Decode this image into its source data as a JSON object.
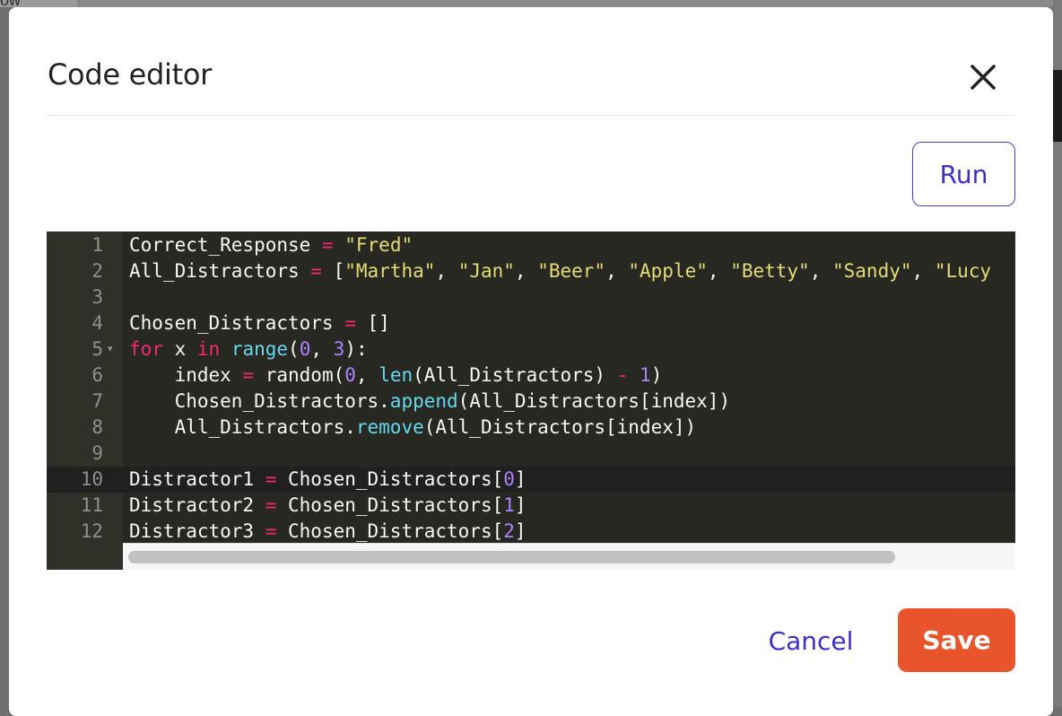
{
  "background": {
    "fragment_text": "ow"
  },
  "modal": {
    "title": "Code editor",
    "close_icon": "close-icon"
  },
  "toolbar": {
    "run_label": "Run"
  },
  "editor": {
    "theme": "monokai",
    "active_line": 10,
    "lines": [
      {
        "number": "1",
        "tokens": [
          {
            "t": "Correct_Response ",
            "c": "pl"
          },
          {
            "t": "=",
            "c": "op"
          },
          {
            "t": " ",
            "c": "pl"
          },
          {
            "t": "\"Fred\"",
            "c": "str"
          }
        ]
      },
      {
        "number": "2",
        "tokens": [
          {
            "t": "All_Distractors ",
            "c": "pl"
          },
          {
            "t": "=",
            "c": "op"
          },
          {
            "t": " [",
            "c": "pl"
          },
          {
            "t": "\"Martha\"",
            "c": "str"
          },
          {
            "t": ", ",
            "c": "pl"
          },
          {
            "t": "\"Jan\"",
            "c": "str"
          },
          {
            "t": ", ",
            "c": "pl"
          },
          {
            "t": "\"Beer\"",
            "c": "str"
          },
          {
            "t": ", ",
            "c": "pl"
          },
          {
            "t": "\"Apple\"",
            "c": "str"
          },
          {
            "t": ", ",
            "c": "pl"
          },
          {
            "t": "\"Betty\"",
            "c": "str"
          },
          {
            "t": ", ",
            "c": "pl"
          },
          {
            "t": "\"Sandy\"",
            "c": "str"
          },
          {
            "t": ", ",
            "c": "pl"
          },
          {
            "t": "\"Lucy",
            "c": "str"
          }
        ]
      },
      {
        "number": "3",
        "tokens": []
      },
      {
        "number": "4",
        "tokens": [
          {
            "t": "Chosen_Distractors ",
            "c": "pl"
          },
          {
            "t": "=",
            "c": "op"
          },
          {
            "t": " []",
            "c": "pl"
          }
        ]
      },
      {
        "number": "5",
        "fold": true,
        "tokens": [
          {
            "t": "for",
            "c": "kw"
          },
          {
            "t": " x ",
            "c": "pl"
          },
          {
            "t": "in",
            "c": "kw"
          },
          {
            "t": " ",
            "c": "pl"
          },
          {
            "t": "range",
            "c": "fn"
          },
          {
            "t": "(",
            "c": "pl"
          },
          {
            "t": "0",
            "c": "num"
          },
          {
            "t": ", ",
            "c": "pl"
          },
          {
            "t": "3",
            "c": "num"
          },
          {
            "t": "):",
            "c": "pl"
          }
        ]
      },
      {
        "number": "6",
        "tokens": [
          {
            "t": "    index ",
            "c": "pl"
          },
          {
            "t": "=",
            "c": "op"
          },
          {
            "t": " random(",
            "c": "pl"
          },
          {
            "t": "0",
            "c": "num"
          },
          {
            "t": ", ",
            "c": "pl"
          },
          {
            "t": "len",
            "c": "fn"
          },
          {
            "t": "(All_Distractors) ",
            "c": "pl"
          },
          {
            "t": "-",
            "c": "op"
          },
          {
            "t": " ",
            "c": "pl"
          },
          {
            "t": "1",
            "c": "num"
          },
          {
            "t": ")",
            "c": "pl"
          }
        ]
      },
      {
        "number": "7",
        "tokens": [
          {
            "t": "    Chosen_Distractors.",
            "c": "pl"
          },
          {
            "t": "append",
            "c": "fn"
          },
          {
            "t": "(All_Distractors[index])",
            "c": "pl"
          }
        ]
      },
      {
        "number": "8",
        "tokens": [
          {
            "t": "    All_Distractors.",
            "c": "pl"
          },
          {
            "t": "remove",
            "c": "fn"
          },
          {
            "t": "(All_Distractors[index])",
            "c": "pl"
          }
        ]
      },
      {
        "number": "9",
        "tokens": []
      },
      {
        "number": "10",
        "tokens": [
          {
            "t": "Distractor1 ",
            "c": "pl"
          },
          {
            "t": "=",
            "c": "op"
          },
          {
            "t": " Chosen_Distractors[",
            "c": "pl"
          },
          {
            "t": "0",
            "c": "num"
          },
          {
            "t": "]",
            "c": "pl"
          }
        ]
      },
      {
        "number": "11",
        "tokens": [
          {
            "t": "Distractor2 ",
            "c": "pl"
          },
          {
            "t": "=",
            "c": "op"
          },
          {
            "t": " Chosen_Distractors[",
            "c": "pl"
          },
          {
            "t": "1",
            "c": "num"
          },
          {
            "t": "]",
            "c": "pl"
          }
        ]
      },
      {
        "number": "12",
        "tokens": [
          {
            "t": "Distractor3 ",
            "c": "pl"
          },
          {
            "t": "=",
            "c": "op"
          },
          {
            "t": " Chosen_Distractors[",
            "c": "pl"
          },
          {
            "t": "2",
            "c": "num"
          },
          {
            "t": "]",
            "c": "pl"
          }
        ]
      }
    ],
    "horizontal_scroll_fraction": 0.87
  },
  "footer": {
    "cancel_label": "Cancel",
    "save_label": "Save"
  },
  "colors": {
    "accent": "#3b2fc9",
    "save": "#e8542b",
    "editor_bg": "#272822",
    "gutter_bg": "#2f3129"
  }
}
